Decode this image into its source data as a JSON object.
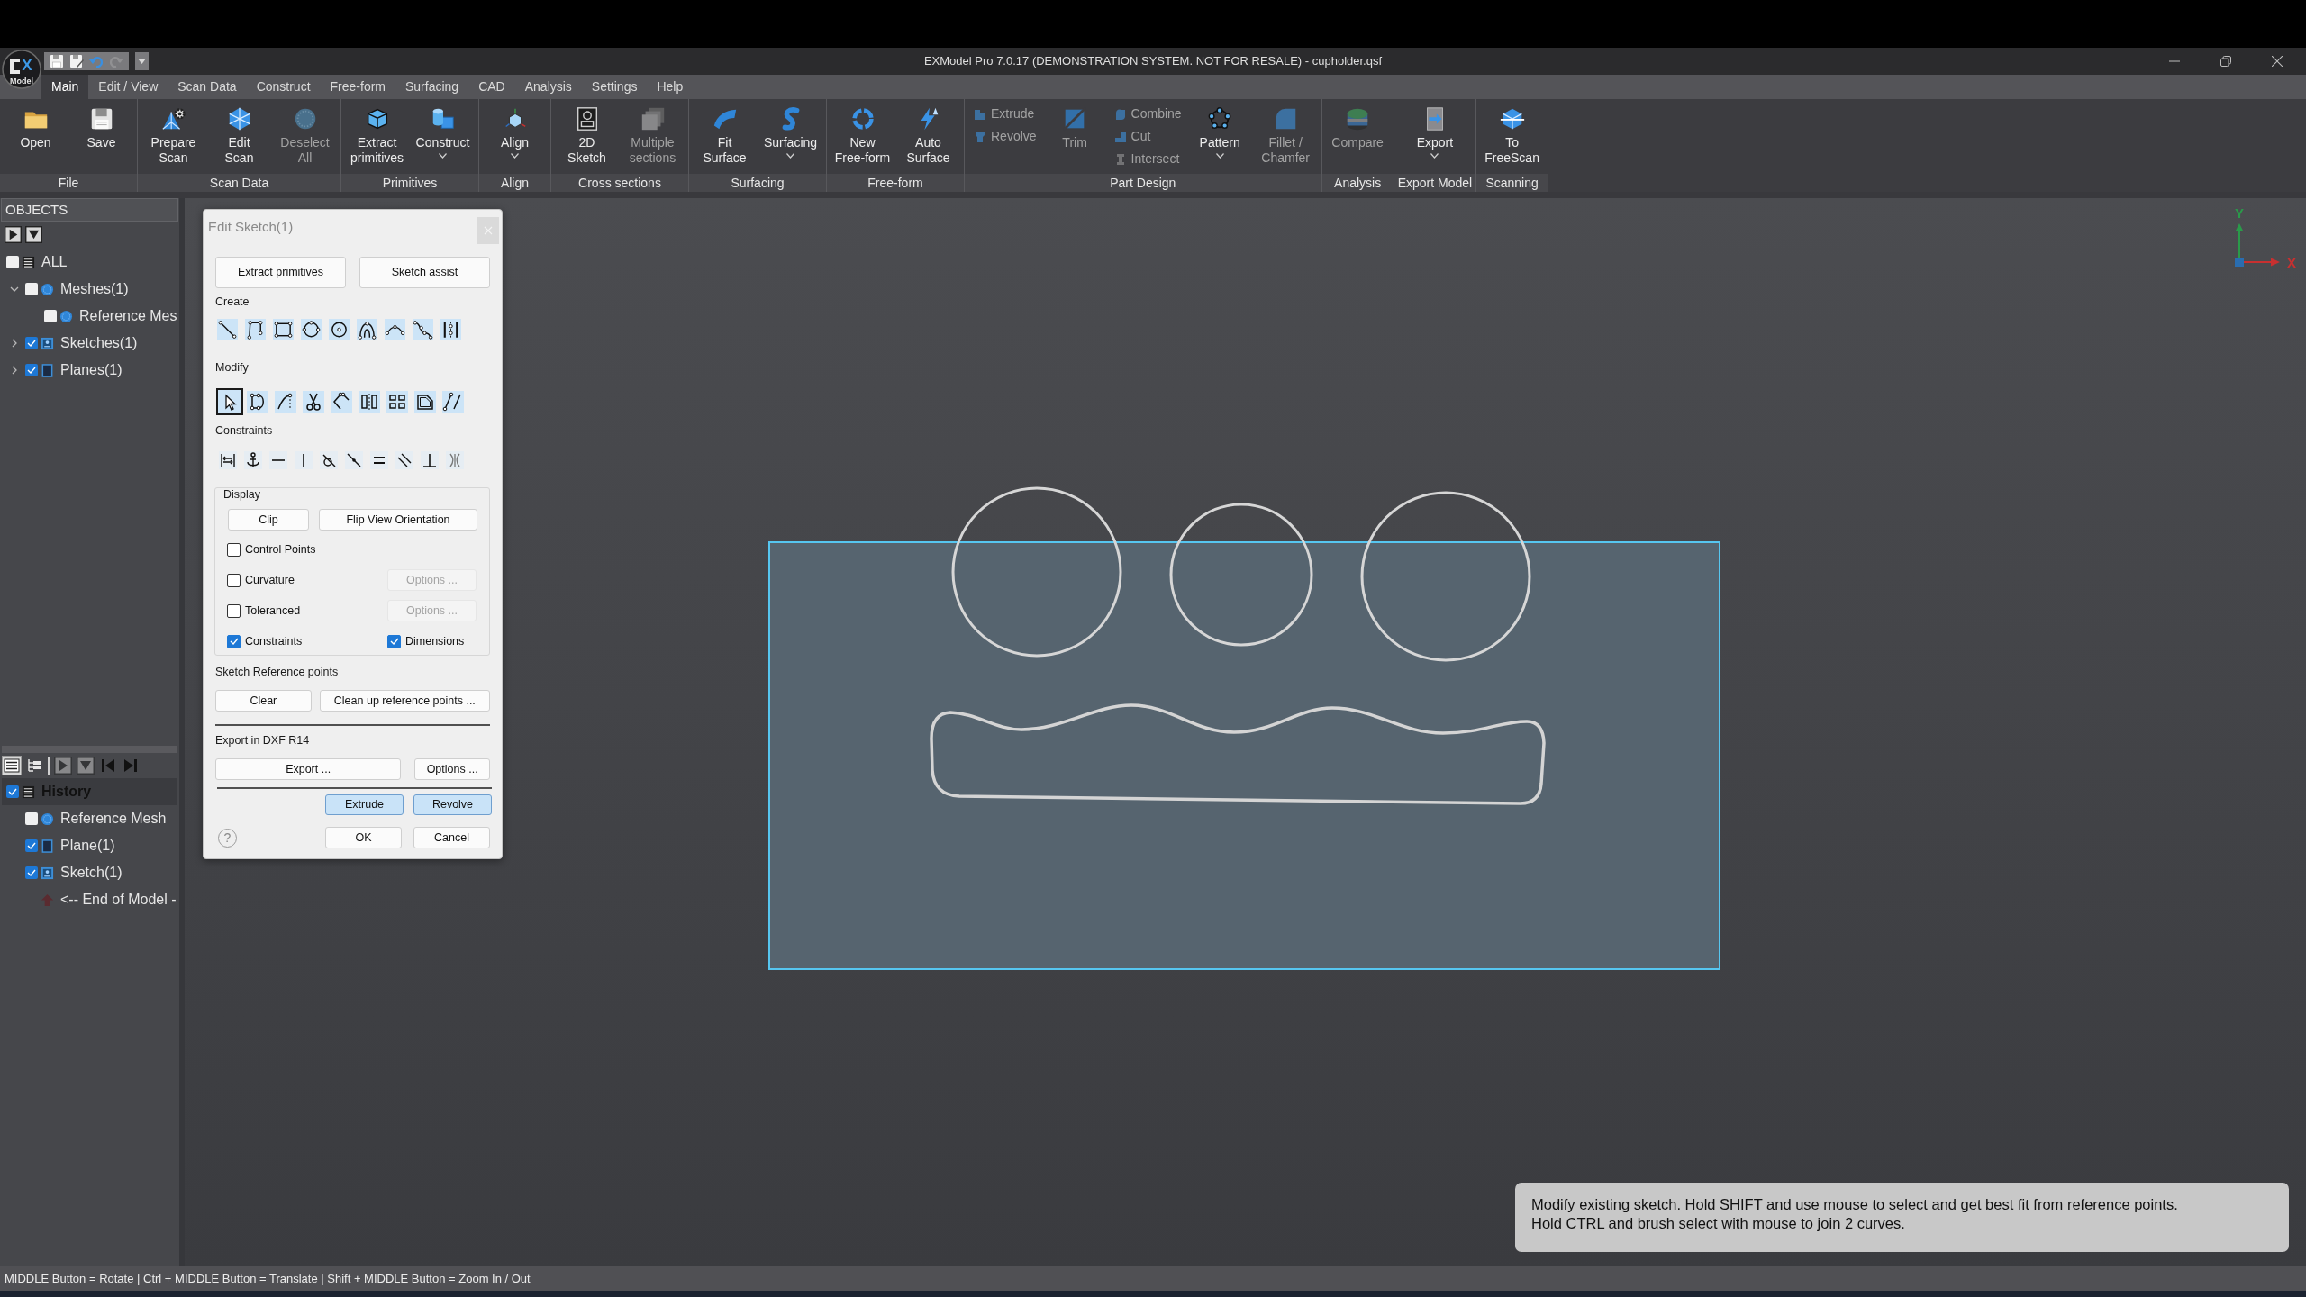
{
  "window": {
    "logo": {
      "mark": "X",
      "caption": "Model"
    },
    "quick_access": [
      {
        "disabled": false
      },
      {
        "disabled": false
      },
      {
        "disabled": false
      },
      {
        "disabled": true
      }
    ],
    "title": "EXModel Pro 7.0.17 (DEMONSTRATION SYSTEM. NOT FOR RESALE) - cupholder.qsf"
  },
  "menu_tabs": [
    {
      "label": "Main",
      "selected": true
    },
    {
      "label": "Edit / View",
      "selected": false
    },
    {
      "label": "Scan Data",
      "selected": false
    },
    {
      "label": "Construct",
      "selected": false
    },
    {
      "label": "Free-form",
      "selected": false
    },
    {
      "label": "Surfacing",
      "selected": false
    },
    {
      "label": "CAD",
      "selected": false
    },
    {
      "label": "Analysis",
      "selected": false
    },
    {
      "label": "Settings",
      "selected": false
    },
    {
      "label": "Help",
      "selected": false
    }
  ],
  "ribbon": {
    "groups": [
      {
        "label": "File",
        "items": [
          {
            "kind": "large",
            "label": "Open",
            "disabled": false,
            "dropdown": false
          },
          {
            "kind": "large",
            "label": "Save",
            "disabled": false,
            "dropdown": false
          }
        ]
      },
      {
        "label": "Scan Data",
        "items": [
          {
            "kind": "large",
            "label": "Prepare\nScan",
            "disabled": false,
            "dropdown": false
          },
          {
            "kind": "large",
            "label": "Edit\nScan",
            "disabled": false,
            "dropdown": false
          },
          {
            "kind": "large",
            "label": "Deselect\nAll",
            "disabled": true,
            "dropdown": false
          }
        ]
      },
      {
        "label": "Primitives",
        "items": [
          {
            "kind": "large",
            "label": "Extract\nprimitives",
            "disabled": false,
            "dropdown": false
          },
          {
            "kind": "large",
            "label": "Construct",
            "disabled": false,
            "dropdown": true
          }
        ]
      },
      {
        "label": "Align",
        "items": [
          {
            "kind": "large",
            "label": "Align",
            "disabled": false,
            "dropdown": true
          }
        ]
      },
      {
        "label": "Cross sections",
        "items": [
          {
            "kind": "large",
            "label": "2D\nSketch",
            "disabled": false,
            "dropdown": false
          },
          {
            "kind": "large",
            "label": "Multiple\nsections",
            "disabled": true,
            "dropdown": false
          }
        ]
      },
      {
        "label": "Surfacing",
        "items": [
          {
            "kind": "large",
            "label": "Fit\nSurface",
            "disabled": false,
            "dropdown": false
          },
          {
            "kind": "large",
            "label": "Surfacing",
            "disabled": false,
            "dropdown": true
          }
        ]
      },
      {
        "label": "Free-form",
        "items": [
          {
            "kind": "large",
            "label": "New\nFree-form",
            "disabled": false,
            "dropdown": false
          },
          {
            "kind": "large",
            "label": "Auto\nSurface",
            "disabled": false,
            "dropdown": false
          }
        ]
      },
      {
        "label": "Part Design",
        "items": [
          {
            "kind": "stack",
            "buttons": [
              {
                "label": "Extrude",
                "disabled": true
              },
              {
                "label": "Revolve",
                "disabled": true
              }
            ]
          },
          {
            "kind": "large",
            "label": "Trim",
            "disabled": true,
            "dropdown": false
          },
          {
            "kind": "stack",
            "buttons": [
              {
                "label": "Combine",
                "disabled": true
              },
              {
                "label": "Cut",
                "disabled": true
              },
              {
                "label": "Intersect",
                "disabled": true
              }
            ]
          },
          {
            "kind": "large",
            "label": "Pattern",
            "disabled": false,
            "dropdown": true
          },
          {
            "kind": "large",
            "label": "Fillet /\nChamfer",
            "disabled": true,
            "dropdown": false
          }
        ]
      },
      {
        "label": "Analysis",
        "items": [
          {
            "kind": "large",
            "label": "Compare",
            "disabled": true,
            "dropdown": false
          }
        ]
      },
      {
        "label": "Export Model",
        "items": [
          {
            "kind": "large",
            "label": "Export",
            "disabled": false,
            "dropdown": true
          }
        ]
      },
      {
        "label": "Scanning",
        "items": [
          {
            "kind": "large",
            "label": "To\nFreeScan",
            "disabled": false,
            "dropdown": false
          }
        ]
      }
    ]
  },
  "objects_panel": {
    "title": "OBJECTS",
    "tree": [
      {
        "label": "ALL",
        "kind": "all",
        "checked": false,
        "children": [
          {
            "label": "Meshes(1)",
            "kind": "mesh",
            "checked": false,
            "expanded": true,
            "children": [
              {
                "label": "Reference Mes",
                "kind": "mesh",
                "checked": false
              }
            ]
          },
          {
            "label": "Sketches(1)",
            "kind": "sketch",
            "checked": true,
            "expanded": false
          },
          {
            "label": "Planes(1)",
            "kind": "plane",
            "checked": true,
            "expanded": false
          }
        ]
      }
    ]
  },
  "history_panel": {
    "toolbar": [
      {
        "selected": true,
        "disabled": false
      },
      {
        "selected": false,
        "disabled": false
      },
      {
        "selected": false,
        "disabled": true
      },
      {
        "selected": false,
        "disabled": true
      },
      {
        "selected": false,
        "disabled": false
      },
      {
        "selected": false,
        "disabled": false
      }
    ],
    "tree": [
      {
        "label": "History",
        "kind": "history",
        "checked": true,
        "selected": true,
        "children": [
          {
            "label": "Reference Mesh",
            "kind": "mesh",
            "checked": false,
            "selected": false
          },
          {
            "label": "Plane(1)",
            "kind": "plane",
            "checked": true,
            "selected": false
          },
          {
            "label": "Sketch(1)",
            "kind": "sketch",
            "checked": true,
            "selected": false
          },
          {
            "label": "<-- End of Model -",
            "kind": "end",
            "selected": false
          }
        ]
      }
    ]
  },
  "edit_sketch_dialog": {
    "title": "Edit Sketch(1)",
    "top_buttons": [
      "Extract primitives",
      "Sketch assist"
    ],
    "create_label": "Create",
    "modify_label": "Modify",
    "modify_tools": [
      {
        "selected": true
      },
      {
        "selected": false
      },
      {
        "selected": false
      },
      {
        "selected": false
      },
      {
        "selected": false
      },
      {
        "selected": false
      },
      {
        "selected": false
      },
      {
        "selected": false
      },
      {
        "selected": false
      }
    ],
    "constraints_label": "Constraints",
    "display": {
      "label": "Display",
      "buttons": [
        "Clip",
        "Flip View Orientation"
      ],
      "rows": [
        [
          {
            "kind": "checkbox",
            "label": "Control Points",
            "checked": false
          }
        ],
        [
          {
            "kind": "checkbox",
            "label": "Curvature",
            "checked": false
          },
          {
            "kind": "button",
            "label": "Options ...",
            "disabled": true
          }
        ],
        [
          {
            "kind": "checkbox",
            "label": "Toleranced",
            "checked": false
          },
          {
            "kind": "button",
            "label": "Options ...",
            "disabled": true
          }
        ],
        [
          {
            "kind": "checkbox",
            "label": "Constraints",
            "checked": true
          },
          {
            "kind": "checkbox",
            "label": "Dimensions",
            "checked": true
          }
        ]
      ]
    },
    "reference_points": {
      "label": "Sketch Reference points",
      "buttons": [
        "Clear",
        "Clean up reference points ..."
      ]
    },
    "export": {
      "label": "Export in DXF R14",
      "buttons": [
        "Export ...",
        "Options ..."
      ]
    },
    "actions": [
      {
        "label": "Extrude",
        "highlighted": true
      },
      {
        "label": "Revolve",
        "highlighted": true
      }
    ],
    "help_glyph": "?",
    "footer_buttons": [
      "OK",
      "Cancel"
    ]
  },
  "viewport": {
    "axis_labels": {
      "y": "Y",
      "x": "X"
    }
  },
  "tooltip": "Modify existing sketch. Hold SHIFT and use mouse to select and get best fit from reference points.\nHold CTRL and brush select with mouse to join 2 curves.",
  "status_bar": "MIDDLE Button = Rotate | Ctrl + MIDDLE Button = Translate | Shift + MIDDLE Button = Zoom In / Out"
}
